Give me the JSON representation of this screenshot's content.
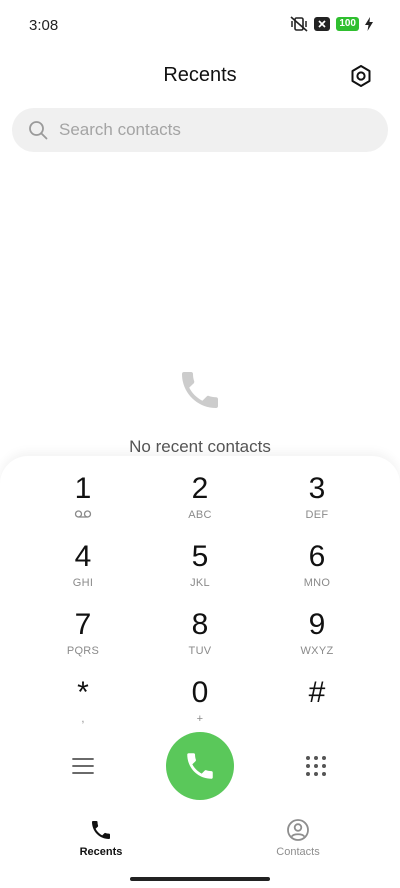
{
  "status_bar": {
    "time": "3:08",
    "battery": "100",
    "icons": [
      "vibrate-off-icon",
      "notification-x-icon",
      "battery-icon",
      "charging-icon"
    ]
  },
  "header": {
    "title": "Recents",
    "settings_icon": "settings-hexagon-icon"
  },
  "search": {
    "placeholder": "Search contacts"
  },
  "empty_state": {
    "icon": "phone-icon",
    "text": "No recent contacts"
  },
  "dialpad": {
    "keys": [
      {
        "digit": "1",
        "letters": ""
      },
      {
        "digit": "2",
        "letters": "ABC"
      },
      {
        "digit": "3",
        "letters": "DEF"
      },
      {
        "digit": "4",
        "letters": "GHI"
      },
      {
        "digit": "5",
        "letters": "JKL"
      },
      {
        "digit": "6",
        "letters": "MNO"
      },
      {
        "digit": "7",
        "letters": "PQRS"
      },
      {
        "digit": "8",
        "letters": "TUV"
      },
      {
        "digit": "9",
        "letters": "WXYZ"
      },
      {
        "digit": "*",
        "letters": ","
      },
      {
        "digit": "0",
        "letters": "+"
      },
      {
        "digit": "#",
        "letters": ""
      }
    ],
    "key1_icon": "voicemail-icon",
    "left_action_icon": "menu-icon",
    "call_icon": "phone-icon",
    "right_action_icon": "dialpad-grid-icon",
    "call_button_color": "#5ac85a"
  },
  "bottom_nav": {
    "items": [
      {
        "label": "Recents",
        "icon": "phone-icon",
        "active": true
      },
      {
        "label": "Contacts",
        "icon": "person-circle-icon",
        "active": false
      }
    ]
  }
}
